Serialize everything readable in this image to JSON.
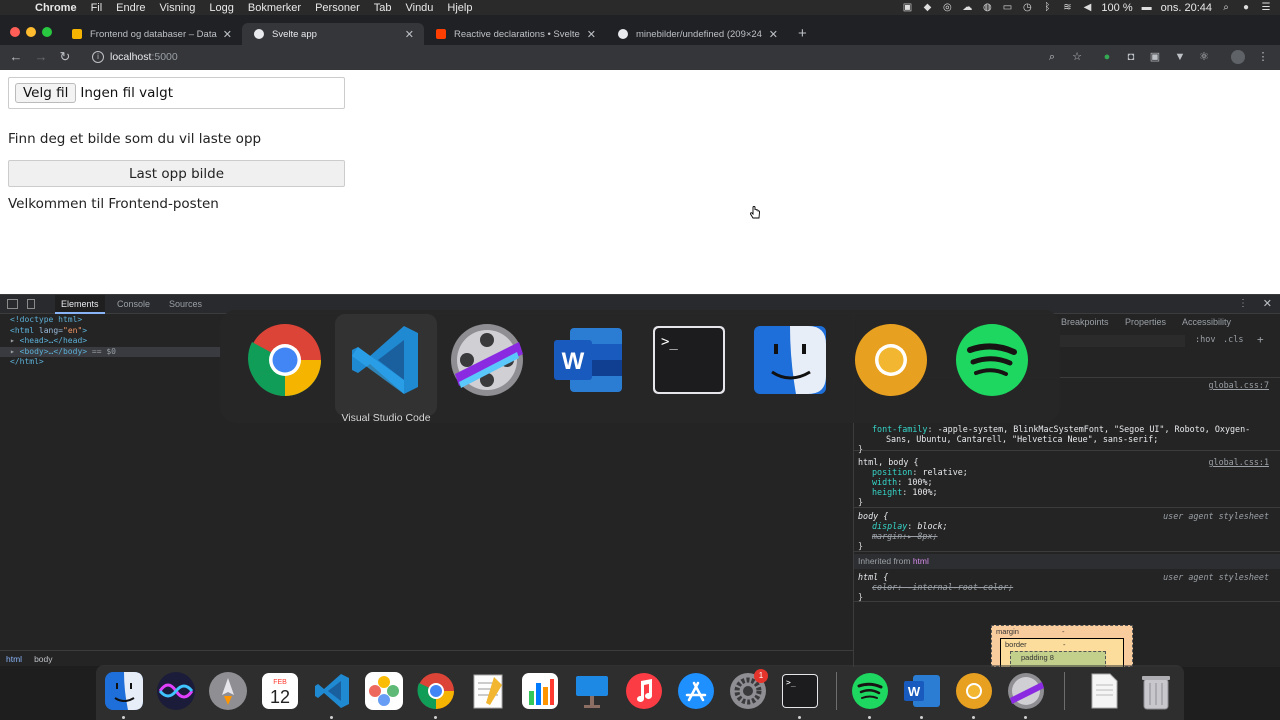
{
  "menubar": {
    "app": "Chrome",
    "menus": [
      "Fil",
      "Endre",
      "Visning",
      "Logg",
      "Bokmerker",
      "Personer",
      "Tab",
      "Vindu",
      "Hjelp"
    ],
    "battery": "100 %",
    "clock": "ons. 20:44"
  },
  "tabs": [
    {
      "title": "Frontend og databaser – Datab",
      "close": "✕",
      "favicon_color": "#f4b400"
    },
    {
      "title": "Svelte app",
      "close": "✕",
      "favicon_color": "#e8eaed"
    },
    {
      "title": "Reactive declarations • Svelte",
      "close": "✕",
      "favicon_color": "#ff3e00"
    },
    {
      "title": "minebilder/undefined (209×24",
      "close": "✕",
      "favicon_color": "#e8eaed"
    }
  ],
  "newtab": "+",
  "address": {
    "host": "localhost",
    "port": ":5000"
  },
  "page": {
    "choose_label": "Velg fil",
    "no_file": "Ingen fil valgt",
    "prompt": "Finn deg et bilde som du vil laste opp",
    "upload_label": "Last opp bilde",
    "welcome": "Velkommen til Frontend-posten"
  },
  "devtools": {
    "tabs": [
      "Elements",
      "Console",
      "Sources"
    ],
    "dom": {
      "l1": "<!doctype html>",
      "l2_open": "<html",
      "l2_attr": " lang=",
      "l2_val": "\"en\"",
      "l2_close": ">",
      "l3": "<head>…</head>",
      "l4": "<body>…</body>",
      "l4_sel": "== $0",
      "l5": "</html>"
    },
    "breadcrumbs": [
      "html",
      "body"
    ],
    "styles_tabs": [
      "Breakpoints",
      "Properties",
      "Accessibility"
    ],
    "hov": ":hov",
    "cls": ".cls",
    "plus": "+",
    "rule1_src": "global.css:7",
    "rule1_prop": "font-family",
    "rule1_val": "-apple-system, BlinkMacSystemFont, \"Segoe UI\", Roboto, Oxygen-",
    "rule1_val2": "Sans, Ubuntu, Cantarell, \"Helvetica Neue\", sans-serif;",
    "rule2_sel": "html, body {",
    "rule2_src": "global.css:1",
    "rule2_props": [
      {
        "n": "position",
        "v": "relative;"
      },
      {
        "n": "width",
        "v": "100%;"
      },
      {
        "n": "height",
        "v": "100%;"
      }
    ],
    "rule3_sel": "body {",
    "rule3_ua": "user agent stylesheet",
    "rule3_p1_n": "display",
    "rule3_p1_v": "block;",
    "rule3_p2": "margin:▸ 8px;",
    "inherited_label": "Inherited from",
    "inherited_tag": "html",
    "rule4_sel": "html {",
    "rule4_ua": "user agent stylesheet",
    "rule4_prop": "color: -internal-root-color;",
    "close_brace": "}",
    "boxmodel": {
      "margin": "margin",
      "border": "border",
      "padding": "padding 8",
      "dash": "-"
    }
  },
  "switcher": {
    "apps": [
      "chrome",
      "vscode",
      "final-cut",
      "word",
      "terminal",
      "finder",
      "chrome-canary",
      "spotify"
    ],
    "selected_label": "Visual Studio Code"
  },
  "dock": {
    "calendar_month": "FEB",
    "calendar_day": "12",
    "settings_badge": "1"
  }
}
